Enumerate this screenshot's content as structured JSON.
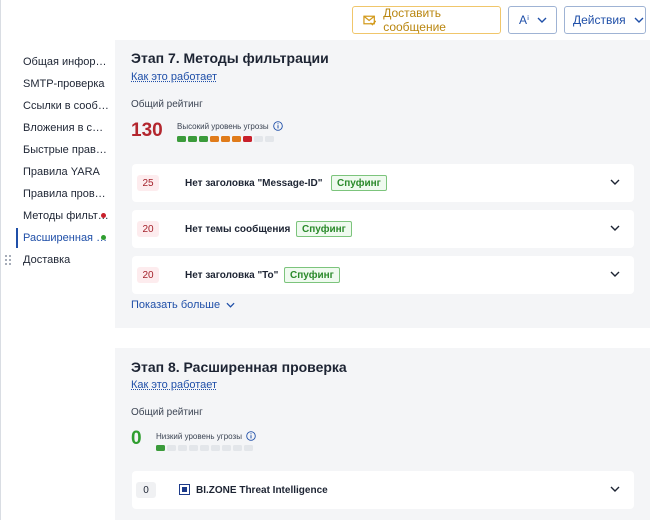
{
  "toolbar": {
    "deliver_label": "Доставить сообщение",
    "font_label": "Aⁱ",
    "actions_label": "Действия"
  },
  "sidebar": {
    "items": [
      {
        "label": "Общая информация",
        "status": ""
      },
      {
        "label": "SMTP-проверка",
        "status": ""
      },
      {
        "label": "Ссылки в сообщении",
        "status": ""
      },
      {
        "label": "Вложения в сообщении",
        "status": ""
      },
      {
        "label": "Быстрые правила",
        "status": ""
      },
      {
        "label": "Правила YARA",
        "status": ""
      },
      {
        "label": "Правила проверки",
        "status": ""
      },
      {
        "label": "Методы фильтрации",
        "status": "red"
      },
      {
        "label": "Расширенная проверка",
        "status": "green",
        "active": true
      },
      {
        "label": "Доставка",
        "status": ""
      }
    ]
  },
  "stage7": {
    "title": "Этап 7. Методы фильтрации",
    "how_it_works": "Как это работает",
    "rating_label": "Общий рейтинг",
    "score": "130",
    "threat_label": "Высокий уровень угрозы",
    "meter_filled": 7,
    "meter_total": 9,
    "meter_colors": [
      "#3b9b3b",
      "#3b9b3b",
      "#3b9b3b",
      "#e07b1a",
      "#e07b1a",
      "#e07b1a",
      "#c8202b"
    ],
    "checks": [
      {
        "score": "25",
        "title": "Нет заголовка \"Message-ID\"",
        "tag": "Спуфинг"
      },
      {
        "score": "20",
        "title": "Нет темы сообщения",
        "tag": "Спуфинг"
      },
      {
        "score": "20",
        "title": "Нет заголовка \"To\"",
        "tag": "Спуфинг"
      }
    ],
    "show_more": "Показать больше"
  },
  "stage8": {
    "title": "Этап 8. Расширенная проверка",
    "how_it_works": "Как это работает",
    "rating_label": "Общий рейтинг",
    "score": "0",
    "threat_label": "Низкий уровень угрозы",
    "meter_filled": 1,
    "meter_total": 9,
    "meter_colors": [
      "#3b9b3b"
    ],
    "checks": [
      {
        "score": "0",
        "title": "BI.ZONE Threat Intelligence"
      }
    ]
  },
  "colors": {
    "accent": "#1f4fa8",
    "high_threat": "#b3262e",
    "low_threat": "#2f9e2f",
    "deliver_accent": "#b9860f"
  }
}
